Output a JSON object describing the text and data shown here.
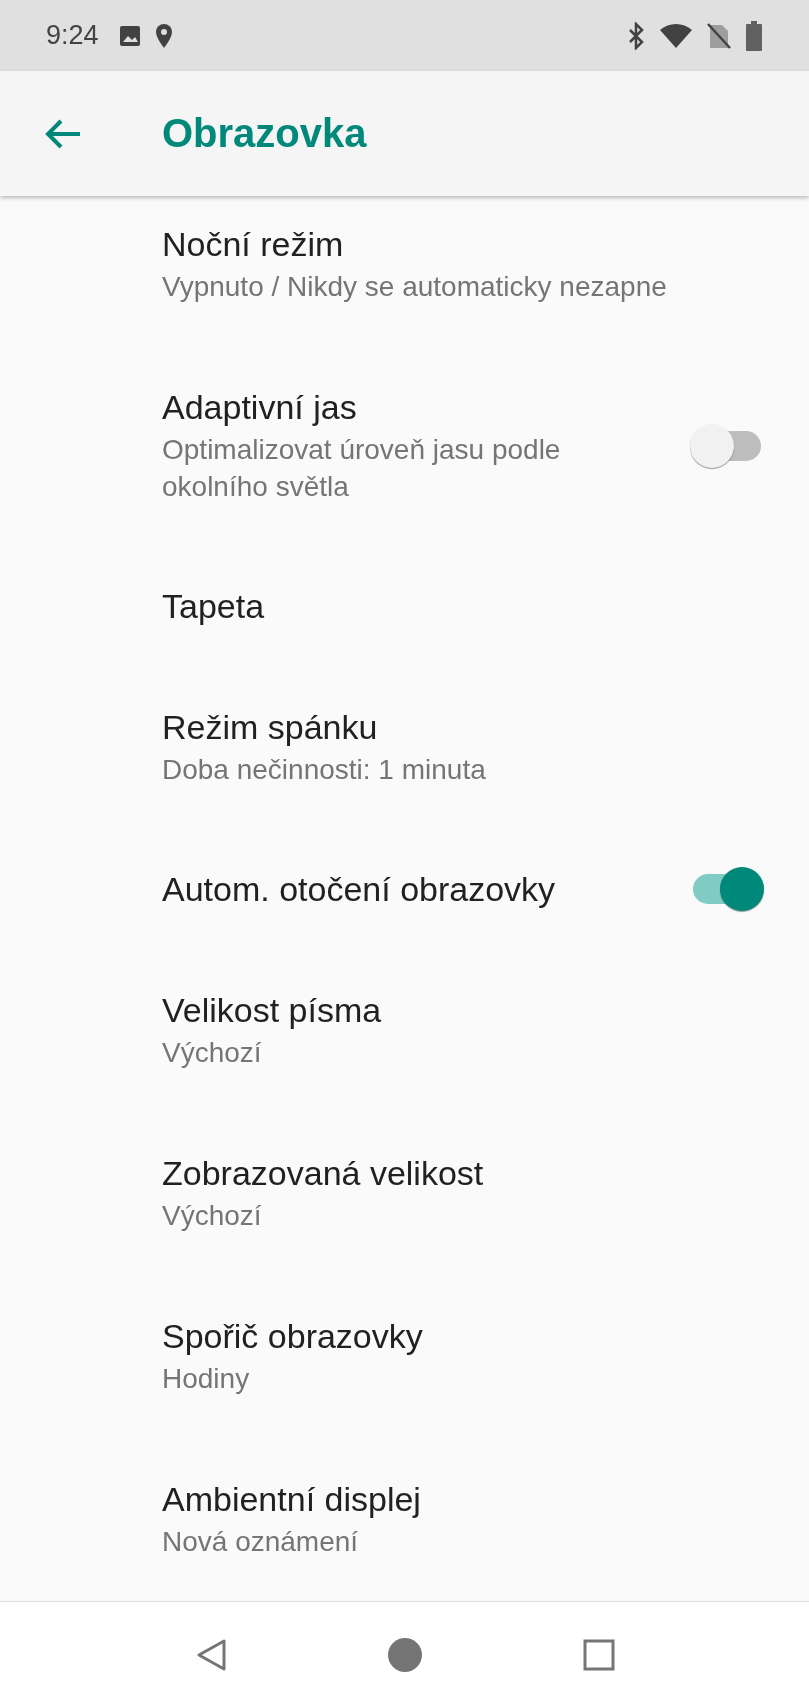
{
  "status_bar": {
    "time": "9:24"
  },
  "app_bar": {
    "title": "Obrazovka"
  },
  "settings": [
    {
      "kind": "text",
      "title": "Noční režim",
      "subtitle": "Vypnuto / Nikdy se automaticky nezapne"
    },
    {
      "kind": "toggle",
      "title": "Adaptivní jas",
      "subtitle": "Optimalizovat úroveň jasu podle okolního světla",
      "on": false
    },
    {
      "kind": "text",
      "title": "Tapeta"
    },
    {
      "kind": "text",
      "title": "Režim spánku",
      "subtitle": "Doba nečinnosti: 1 minuta"
    },
    {
      "kind": "toggle",
      "title": "Autom. otočení obrazovky",
      "on": true
    },
    {
      "kind": "text",
      "title": "Velikost písma",
      "subtitle": "Výchozí"
    },
    {
      "kind": "text",
      "title": "Zobrazovaná velikost",
      "subtitle": "Výchozí"
    },
    {
      "kind": "text",
      "title": "Spořič obrazovky",
      "subtitle": "Hodiny"
    },
    {
      "kind": "text",
      "title": "Ambientní displej",
      "subtitle": "Nová oznámení"
    }
  ]
}
